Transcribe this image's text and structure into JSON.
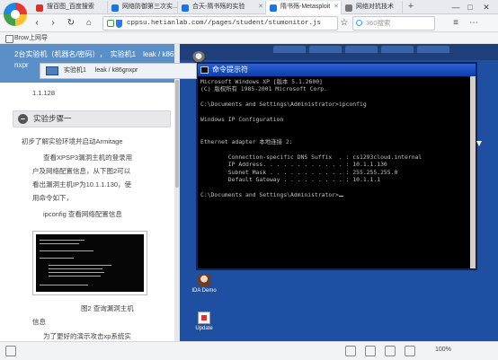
{
  "browser": {
    "tabs": [
      {
        "label": "搜百图_百度搜索",
        "color": "#d93025",
        "active": false
      },
      {
        "label": "网络防御第三次实...",
        "color": "#1a73e8",
        "active": false
      },
      {
        "label": "合天-隋书殇的实验",
        "color": "#1a73e8",
        "active": false
      },
      {
        "label": "隋书殇-Metasploit",
        "color": "#1a73e8",
        "active": true
      },
      {
        "label": "网络对抗技术",
        "color": "#555",
        "active": false
      }
    ],
    "add_tab": "+",
    "controls": {
      "minimize": "—",
      "maximize": "□",
      "close": "✕"
    },
    "nav": {
      "back": "‹",
      "forward": "›",
      "reload": "↻",
      "home": "⌂",
      "star": "☆"
    },
    "url": "cppsu.hetianlab.com//pages/student/stumonitor.js",
    "search_placeholder": "360搜索",
    "bookmark": "Brow上网导"
  },
  "lesson": {
    "breadcrumb": [
      "2台实验机（机器名/密码）",
      "实验机1",
      "leak / k86ig"
    ],
    "breadcrumb_line2": "nxpr",
    "ip_line": "1.1.128",
    "step_title": "实验步骤一",
    "paragraphs": [
      "初步了解实验环境并启动Armitage",
      "查看XPSP3漏洞主机的登录用",
      "户及网络配置信息，从下图2可以",
      "看出漏洞主机IP为10.1.1.130，使",
      "用命令如下，",
      "ipconfig 查看网络配置信息"
    ],
    "figure_caption": "图2 查询漏洞主机",
    "figure_caption_2": "信息",
    "after_text": "为了更好的演示攻击xp系统实"
  },
  "remote": {
    "vm_label": "实验机1",
    "vm_host": "leak / k86gnxpr",
    "desktop_icons": [
      {
        "label": "IDA Demo",
        "icon": "ida-icon"
      },
      {
        "label": "Update",
        "icon": "update-icon"
      }
    ]
  },
  "cmd": {
    "title": "命令提示符",
    "lines": [
      "Microsoft Windows XP [版本 5.1.2600]",
      "(C) 版权所有 1985-2001 Microsoft Corp.",
      "",
      "C:\\Documents and Settings\\Administrator>ipconfig",
      "",
      "Windows IP Configuration",
      "",
      "",
      "Ethernet adapter 本地连接 2:",
      "",
      "        Connection-specific DNS Suffix  . : cs1293cloud.internal",
      "        IP Address. . . . . . . . . . . . : 10.1.1.130",
      "        Subnet Mask . . . . . . . . . . . : 255.255.255.0",
      "        Default Gateway . . . . . . . . . : 10.1.1.1",
      "",
      "C:\\Documents and Settings\\Administrator>"
    ]
  },
  "status": {
    "zoom": "100%"
  }
}
